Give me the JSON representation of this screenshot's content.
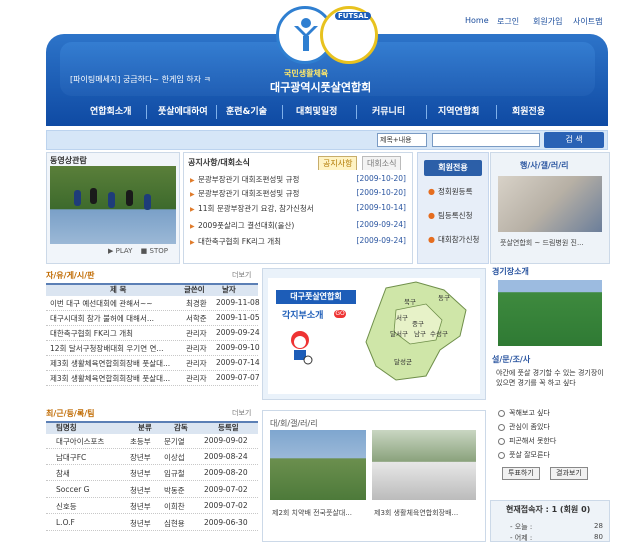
{
  "toplinks": [
    "Home",
    "로그인",
    "회원가입",
    "사이트맵"
  ],
  "ticker": "[파이팅메세지] 궁금하다~ 한게임 하자 ㅋ",
  "brand": {
    "sub": "국민생활체육",
    "main": "대구광역시풋살연합회",
    "badge": "FUTSAL"
  },
  "nav": [
    "연합회소개",
    "풋살에대하여",
    "훈련&기술",
    "대회및일정",
    "커뮤니티",
    "지역연합회",
    "회원전용"
  ],
  "search": {
    "select": "제목+내용",
    "button": "검 색"
  },
  "video": {
    "title": "동영상관람",
    "play": "PLAY",
    "stop": "STOP"
  },
  "notice": {
    "tabs": [
      "공지사항/대회소식",
      "공지사항",
      "대회소식"
    ],
    "rows": [
      {
        "title": "문광부장관기 대회조편성및 규정",
        "date": "[2009-10-20]"
      },
      {
        "title": "문광부장관기 대회조편성및 규정",
        "date": "[2009-10-20]"
      },
      {
        "title": "11회 문광부장관기 요강, 참가신청서",
        "date": "[2009-10-14]"
      },
      {
        "title": "2009풋살리그 결선대회(울산)",
        "date": "[2009-09-24]"
      },
      {
        "title": "대한축구협회 FK리그 개최",
        "date": "[2009-09-24]"
      }
    ]
  },
  "member": {
    "title": "회원전용",
    "links": [
      "정회원등록",
      "팀등록신청",
      "대회참가신청"
    ]
  },
  "gallery_photo": {
    "title": "행/사/갤/러/리",
    "caption": "풋살연합회 ~ 드림병원 진..."
  },
  "stadium": {
    "title": "경기장소개"
  },
  "free_board": {
    "title": "자/유/게/시/판",
    "more": "더보기",
    "headers": [
      "제 목",
      "글쓴이",
      "날자"
    ],
    "rows": [
      {
        "title": "이번 대구 예선대회에 관해서~~",
        "author": "최경환",
        "date": "2009-11-08"
      },
      {
        "title": "대구시대회 참가 불허에 대해서...",
        "author": "서학준",
        "date": "2009-11-05"
      },
      {
        "title": "대한축구협회 FK리그 개최",
        "author": "관리자",
        "date": "2009-09-24"
      },
      {
        "title": "12회 달서구청장배대회 우기연 연...",
        "author": "관리자",
        "date": "2009-09-10"
      },
      {
        "title": "제3회 생활체육연합회회장배 풋살대...",
        "author": "관리자",
        "date": "2009-07-14"
      },
      {
        "title": "제3회 생활체육연합회회장배 풋살대...",
        "author": "관리자",
        "date": "2009-07-07"
      }
    ]
  },
  "region": {
    "title": "대구풋살연합회",
    "subtitle": "각지부소개",
    "go": "GO",
    "districts": [
      "북구",
      "동구",
      "서구",
      "중구",
      "달서구",
      "남구",
      "수성구",
      "달성군"
    ]
  },
  "survey": {
    "title": "설/문/조/사",
    "question": "야간에 풋살 경기할 수 있는 경기장이 있으면 경기를 꼭 하고 싶다",
    "options": [
      "꼭해보고 싶다",
      "관심이 좀있다",
      "피곤해서 못한다",
      "풋살 잘모른다"
    ],
    "vote": "투표하기",
    "result": "결과보기"
  },
  "teams": {
    "title": "최/근/등/록/팀",
    "more": "더보기",
    "headers": [
      "팀명칭",
      "분류",
      "감독",
      "등록일"
    ],
    "rows": [
      {
        "name": "대구아이스포츠",
        "type": "초등부",
        "coach": "문기열",
        "date": "2009-09-02"
      },
      {
        "name": "남대구FC",
        "type": "장년부",
        "coach": "이상섭",
        "date": "2009-08-24"
      },
      {
        "name": "참새",
        "type": "청년부",
        "coach": "임규철",
        "date": "2009-08-20"
      },
      {
        "name": "Soccer G",
        "type": "청년부",
        "coach": "박동준",
        "date": "2009-07-02"
      },
      {
        "name": "신호등",
        "type": "청년부",
        "coach": "이희찬",
        "date": "2009-07-02"
      },
      {
        "name": "L.O.F",
        "type": "청년부",
        "coach": "심현용",
        "date": "2009-06-30"
      }
    ]
  },
  "gallery2": {
    "title": "대/회/갤/러/리",
    "captions": [
      "제2회 치약배 전국풋살대...",
      "제3회 생활체육연합회장배..."
    ]
  },
  "visitors": {
    "title": "현재접속자 : 1 (회원 0)",
    "today_label": "- 오늘 :",
    "today": "28",
    "yesterday_label": "- 어제 :",
    "yesterday": "80"
  }
}
